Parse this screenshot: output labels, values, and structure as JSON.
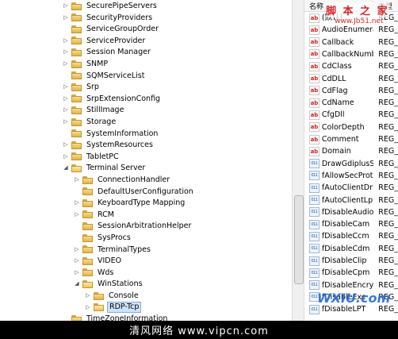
{
  "tree": {
    "items": [
      {
        "label": "SecurePipeServers",
        "depth": 0,
        "exp": "collapsed"
      },
      {
        "label": "SecurityProviders",
        "depth": 0,
        "exp": "collapsed"
      },
      {
        "label": "ServiceGroupOrder",
        "depth": 0,
        "exp": "none"
      },
      {
        "label": "ServiceProvider",
        "depth": 0,
        "exp": "collapsed"
      },
      {
        "label": "Session Manager",
        "depth": 0,
        "exp": "collapsed"
      },
      {
        "label": "SNMP",
        "depth": 0,
        "exp": "collapsed"
      },
      {
        "label": "SQMServiceList",
        "depth": 0,
        "exp": "none"
      },
      {
        "label": "Srp",
        "depth": 0,
        "exp": "collapsed"
      },
      {
        "label": "SrpExtensionConfig",
        "depth": 0,
        "exp": "collapsed"
      },
      {
        "label": "StillImage",
        "depth": 0,
        "exp": "collapsed"
      },
      {
        "label": "Storage",
        "depth": 0,
        "exp": "collapsed"
      },
      {
        "label": "SystemInformation",
        "depth": 0,
        "exp": "none"
      },
      {
        "label": "SystemResources",
        "depth": 0,
        "exp": "collapsed"
      },
      {
        "label": "TabletPC",
        "depth": 0,
        "exp": "collapsed"
      },
      {
        "label": "Terminal Server",
        "depth": 0,
        "exp": "expanded"
      },
      {
        "label": "ConnectionHandler",
        "depth": 1,
        "exp": "collapsed"
      },
      {
        "label": "DefaultUserConfiguration",
        "depth": 1,
        "exp": "none"
      },
      {
        "label": "KeyboardType Mapping",
        "depth": 1,
        "exp": "collapsed"
      },
      {
        "label": "RCM",
        "depth": 1,
        "exp": "collapsed"
      },
      {
        "label": "SessionArbitrationHelper",
        "depth": 1,
        "exp": "none"
      },
      {
        "label": "SysProcs",
        "depth": 1,
        "exp": "none"
      },
      {
        "label": "TerminalTypes",
        "depth": 1,
        "exp": "collapsed"
      },
      {
        "label": "VIDEO",
        "depth": 1,
        "exp": "collapsed"
      },
      {
        "label": "Wds",
        "depth": 1,
        "exp": "collapsed"
      },
      {
        "label": "WinStations",
        "depth": 1,
        "exp": "expanded"
      },
      {
        "label": "Console",
        "depth": 2,
        "exp": "collapsed"
      },
      {
        "label": "RDP-Tcp",
        "depth": 2,
        "exp": "collapsed",
        "selected": true
      },
      {
        "label": "TimeZoneInformation",
        "depth": 0,
        "exp": "none"
      }
    ]
  },
  "list": {
    "header": {
      "name": "名称",
      "type": "类型"
    },
    "rows": [
      {
        "name": "(默认)",
        "type": "REG_",
        "icon": "ab"
      },
      {
        "name": "AudioEnumera...",
        "type": "REG_",
        "icon": "ab"
      },
      {
        "name": "Callback",
        "type": "REG_",
        "icon": "ab"
      },
      {
        "name": "CallbackNumb...",
        "type": "REG_",
        "icon": "ab"
      },
      {
        "name": "CdClass",
        "type": "REG_",
        "icon": "ab"
      },
      {
        "name": "CdDLL",
        "type": "REG_",
        "icon": "ab"
      },
      {
        "name": "CdFlag",
        "type": "REG_",
        "icon": "ab"
      },
      {
        "name": "CdName",
        "type": "REG_",
        "icon": "ab"
      },
      {
        "name": "CfgDll",
        "type": "REG_",
        "icon": "ab"
      },
      {
        "name": "ColorDepth",
        "type": "REG_",
        "icon": "ab"
      },
      {
        "name": "Comment",
        "type": "REG_",
        "icon": "ab"
      },
      {
        "name": "Domain",
        "type": "REG_",
        "icon": "ab"
      },
      {
        "name": "DrawGdiplusS...",
        "type": "REG_",
        "icon": "bin"
      },
      {
        "name": "fAllowSecProto...",
        "type": "REG_",
        "icon": "bin"
      },
      {
        "name": "fAutoClientDriv...",
        "type": "REG_",
        "icon": "bin"
      },
      {
        "name": "fAutoClientLpts",
        "type": "REG_",
        "icon": "bin"
      },
      {
        "name": "fDisableAudio...",
        "type": "REG_",
        "icon": "bin"
      },
      {
        "name": "fDisableCam",
        "type": "REG_",
        "icon": "bin"
      },
      {
        "name": "fDisableCcm",
        "type": "REG_",
        "icon": "bin"
      },
      {
        "name": "fDisableCdm",
        "type": "REG_",
        "icon": "bin"
      },
      {
        "name": "fDisableClip",
        "type": "REG_",
        "icon": "bin"
      },
      {
        "name": "fDisableCpm",
        "type": "REG_",
        "icon": "bin"
      },
      {
        "name": "fDisableEncryp...",
        "type": "REG_",
        "icon": "bin"
      },
      {
        "name": "fDisableExe",
        "type": "REG_",
        "icon": "bin"
      },
      {
        "name": "fDisableLPT",
        "type": "REG_",
        "icon": "bin"
      }
    ]
  },
  "watermark": {
    "top": "脚 本 之 家",
    "url": "www.Jb51.net"
  },
  "logo_text": "WXIU.com",
  "footer": "清风网络 www.vipcn.com"
}
